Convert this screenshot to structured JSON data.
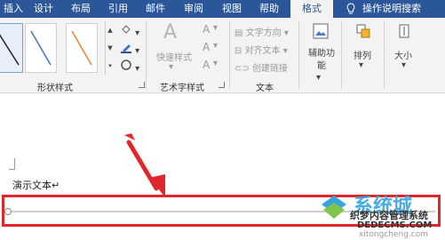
{
  "tabs": [
    {
      "label": "插入",
      "active": false
    },
    {
      "label": "设计",
      "active": false
    },
    {
      "label": "布局",
      "active": false
    },
    {
      "label": "引用",
      "active": false
    },
    {
      "label": "邮件",
      "active": false
    },
    {
      "label": "审阅",
      "active": false
    },
    {
      "label": "视图",
      "active": false
    },
    {
      "label": "帮助",
      "active": false
    },
    {
      "label": "格式",
      "active": true
    }
  ],
  "search_tab": {
    "label": "操作说明搜索",
    "icon": "lightbulb-icon"
  },
  "groups": {
    "shape_styles": {
      "label": "形状样式",
      "gallery_colors": [
        "#222222",
        "#4472c4",
        "#ed7d31"
      ],
      "fill_icon": "paint-bucket-icon",
      "outline_icon": "pen-outline-icon",
      "effects_icon": "shape-effects-icon"
    },
    "wordart": {
      "label": "艺术字样式",
      "quick_styles": "快速样式",
      "text_fill": "A",
      "text_outline": "A",
      "text_effects": "A"
    },
    "text": {
      "label": "文本",
      "text_direction": "文字方向",
      "align_text": "对齐文本",
      "create_link": "创建链接"
    },
    "accessibility": {
      "label": "辅助功能"
    },
    "arrange": {
      "label": "排列"
    },
    "size": {
      "label": "大小"
    }
  },
  "document": {
    "text": "演示文本↵"
  },
  "watermark": {
    "logo_text": "系统城",
    "site_text": "织梦内容管理系统",
    "url1": "DEDECMS.COM",
    "url2": "xitongcheng.com"
  },
  "colors": {
    "tabbar": "#2b579a",
    "highlight": "#e0282c"
  }
}
